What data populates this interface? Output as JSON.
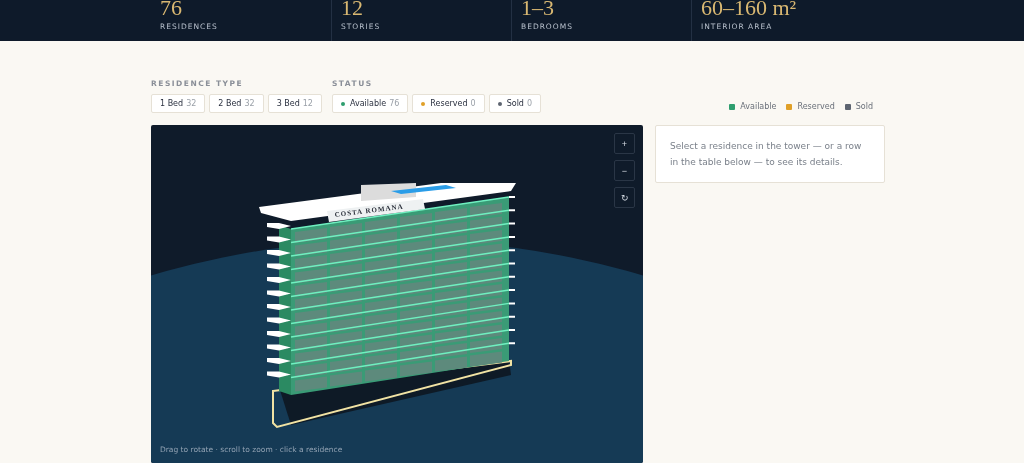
{
  "stats": [
    {
      "value": "76",
      "label": "RESIDENCES"
    },
    {
      "value": "12",
      "label": "STORIES"
    },
    {
      "value": "1–3",
      "label": "BEDROOMS"
    },
    {
      "value": "60–160 m²",
      "label": "INTERIOR AREA"
    }
  ],
  "residence_type": {
    "title": "RESIDENCE TYPE",
    "options": [
      {
        "label": "1 Bed",
        "count": "32"
      },
      {
        "label": "2 Bed",
        "count": "32"
      },
      {
        "label": "3 Bed",
        "count": "12"
      }
    ]
  },
  "status": {
    "title": "STATUS",
    "options": [
      {
        "label": "Available",
        "count": "76",
        "color": "#2e9e6e"
      },
      {
        "label": "Reserved",
        "count": "0",
        "color": "#e0a028"
      },
      {
        "label": "Sold",
        "count": "0",
        "color": "#5d6470"
      }
    ]
  },
  "legend": [
    {
      "label": "Available",
      "color": "#2e9e6e"
    },
    {
      "label": "Reserved",
      "color": "#e0a028"
    },
    {
      "label": "Sold",
      "color": "#5d6470"
    }
  ],
  "viewer": {
    "sign_text": "COSTA ROMANA",
    "controls": [
      "+",
      "−",
      "↻"
    ],
    "hint": "Drag to rotate · scroll to zoom · click a residence"
  },
  "detail_panel": {
    "message": "Select a residence in the tower — or a row in the table below — to see its details."
  }
}
